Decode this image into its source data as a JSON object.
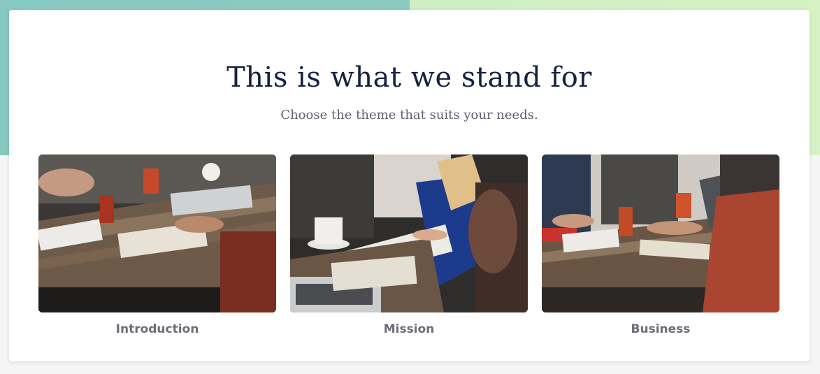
{
  "header": {
    "title": "This is what we stand for",
    "subtitle": "Choose the theme that suits your needs."
  },
  "tiles": [
    {
      "label": "Introduction",
      "image": "meeting-table-photo"
    },
    {
      "label": "Mission",
      "image": "notebook-writing-photo"
    },
    {
      "label": "Business",
      "image": "team-laptop-photo"
    }
  ],
  "colors": {
    "bg_left": "#86c9c0",
    "bg_right": "#d3f1c4",
    "title": "#16213f",
    "label": "#6b6e78"
  }
}
